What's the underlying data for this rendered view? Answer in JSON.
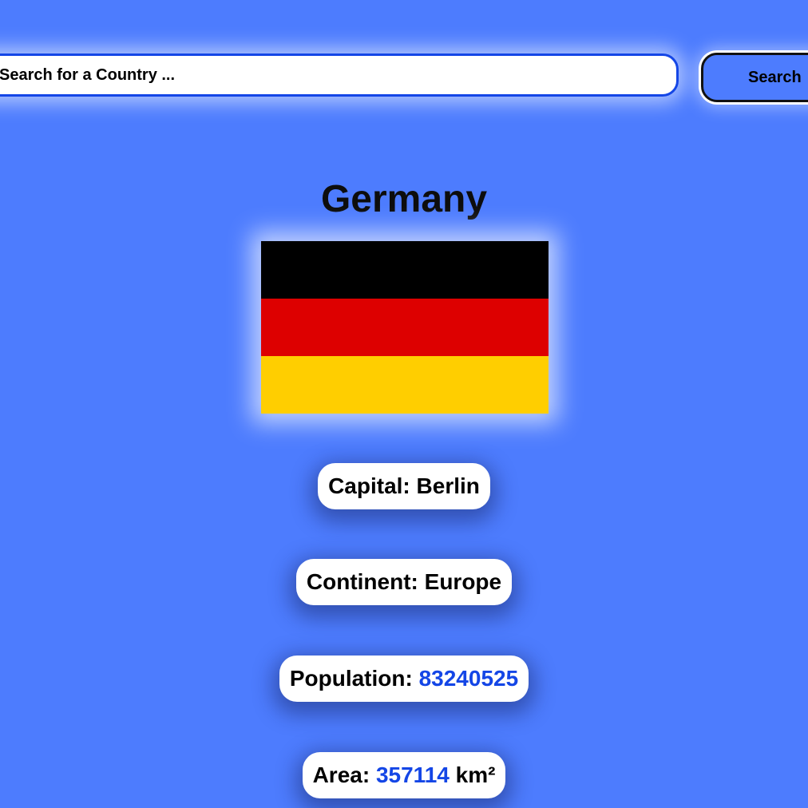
{
  "search": {
    "placeholder": "Search for a Country ...",
    "button_label": "Search"
  },
  "country": {
    "name": "Germany",
    "flag": {
      "stripes": [
        "#000000",
        "#dd0000",
        "#ffce00"
      ]
    },
    "capital": {
      "label": "Capital:",
      "value": "Berlin"
    },
    "continent": {
      "label": "Continent:",
      "value": "Europe"
    },
    "population": {
      "label": "Population:",
      "value": "83240525"
    },
    "area": {
      "label": "Area:",
      "value": "357114",
      "unit": "km²"
    }
  },
  "colors": {
    "background": "#4d7cfe",
    "accent": "#1446e6"
  }
}
